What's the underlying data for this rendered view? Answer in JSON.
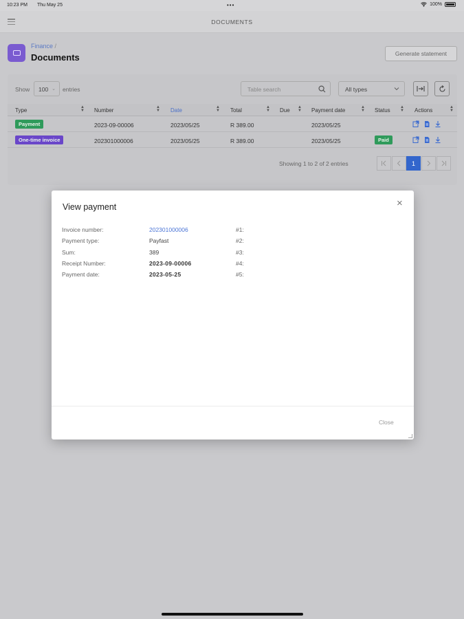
{
  "status_bar": {
    "time": "10:23 PM",
    "date": "Thu May 25",
    "dots": "•••",
    "battery": "100%"
  },
  "app_bar": {
    "title": "DOCUMENTS",
    "menu_icon": "hamburger-icon"
  },
  "page": {
    "breadcrumb": "Finance",
    "breadcrumb_sep": "/",
    "title": "Documents",
    "generate_label": "Generate statement"
  },
  "toolbar": {
    "show_label": "Show",
    "page_size": "100",
    "entries_label": "entries",
    "search_placeholder": "Table search",
    "type_filter": "All types"
  },
  "table": {
    "columns": [
      "Type",
      "Number",
      "Date",
      "Total",
      "Due",
      "Payment date",
      "Status",
      "Actions"
    ],
    "sorted_column": "Date",
    "rows": [
      {
        "type": "Payment",
        "type_color": "#2f9a5b",
        "number": "2023-09-00006",
        "date": "2023/05/25",
        "total": "R 389.00",
        "due": "",
        "payment_date": "2023/05/25",
        "status": ""
      },
      {
        "type": "One-time invoice",
        "type_color": "#6a46c9",
        "number": "202301000006",
        "date": "2023/05/25",
        "total": "R 389.00",
        "due": "",
        "payment_date": "2023/05/25",
        "status": "Paid"
      }
    ],
    "showing": "Showing 1 to 2 of 2 entries",
    "current_page": "1"
  },
  "modal": {
    "title": "View payment",
    "fields": [
      {
        "label": "Invoice number:",
        "value": "202301000006"
      },
      {
        "label": "Payment type:",
        "value": "Payfast"
      },
      {
        "label": "Sum:",
        "value": "389"
      },
      {
        "label": "Receipt Number:",
        "value": "2023-09-00006"
      },
      {
        "label": "Payment date:",
        "value": "2023-05-25"
      }
    ],
    "hashes": [
      "#1:",
      "#2:",
      "#3:",
      "#4:",
      "#5:"
    ],
    "close_label": "Close"
  },
  "colors": {
    "accent": "#3366cc",
    "paid": "#2f9a5b",
    "invoice": "#6a46c9",
    "link": "#4a74d6"
  }
}
